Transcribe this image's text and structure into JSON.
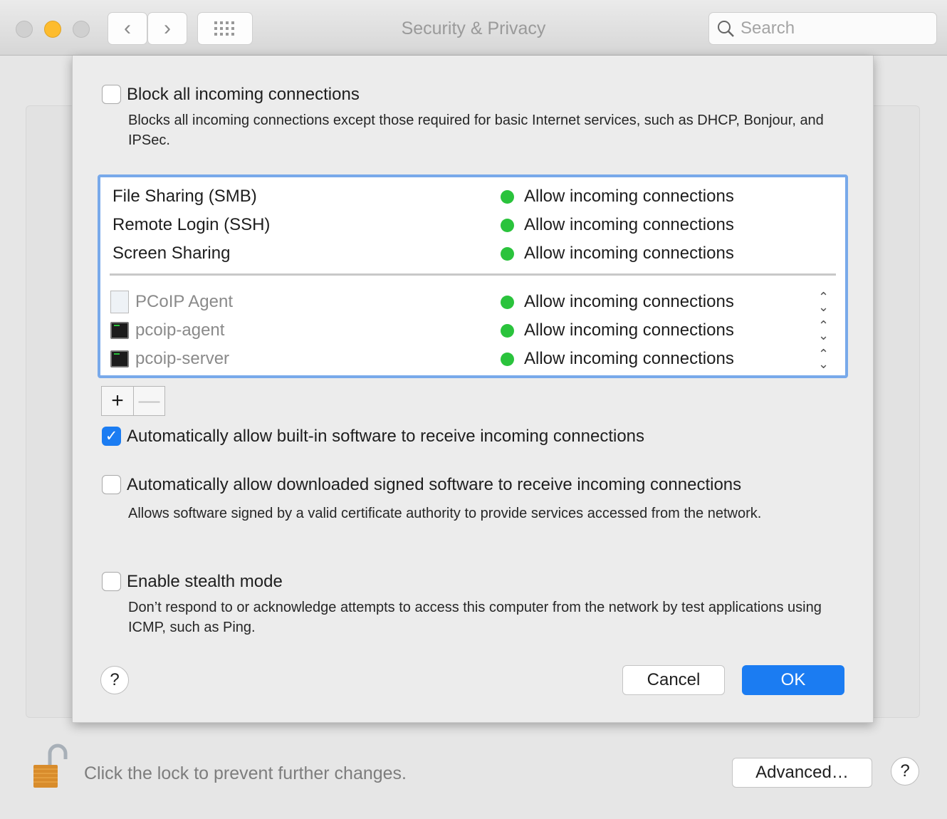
{
  "window": {
    "title": "Security & Privacy",
    "search_placeholder": "Search"
  },
  "sheet": {
    "block_all": {
      "label": "Block all incoming connections",
      "checked": false,
      "description": "Blocks all incoming connections except those required for basic Internet services, such as DHCP, Bonjour, and IPSec."
    },
    "services": [
      {
        "name": "File Sharing (SMB)",
        "status": "Allow incoming connections"
      },
      {
        "name": "Remote Login (SSH)",
        "status": "Allow incoming connections"
      },
      {
        "name": "Screen Sharing",
        "status": "Allow incoming connections"
      }
    ],
    "apps": [
      {
        "name": "PCoIP Agent",
        "icon": "app-document-icon",
        "status": "Allow incoming connections"
      },
      {
        "name": "pcoip-agent",
        "icon": "terminal-icon",
        "status": "Allow incoming connections"
      },
      {
        "name": "pcoip-server",
        "icon": "terminal-icon",
        "status": "Allow incoming connections"
      }
    ],
    "status_color": "#2ac33c",
    "add_label": "+",
    "remove_label": "—",
    "auto_builtin": {
      "label": "Automatically allow built-in software to receive incoming connections",
      "checked": true
    },
    "auto_signed": {
      "label": "Automatically allow downloaded signed software to receive incoming connections",
      "checked": false,
      "description": "Allows software signed by a valid certificate authority to provide services accessed from the network."
    },
    "stealth": {
      "label": "Enable stealth mode",
      "checked": false,
      "description": "Don’t respond to or acknowledge attempts to access this computer from the network by test applications using ICMP, such as Ping."
    },
    "help": "?",
    "cancel": "Cancel",
    "ok": "OK"
  },
  "footer": {
    "lock_text": "Click the lock to prevent further changes.",
    "advanced": "Advanced…",
    "help": "?"
  },
  "accent": "#1b7cf2"
}
